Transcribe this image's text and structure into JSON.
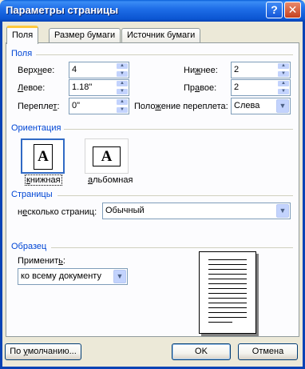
{
  "window": {
    "title": "Параметры страницы",
    "help_glyph": "?",
    "close_glyph": "✕"
  },
  "tabs": [
    {
      "label": "Поля",
      "active": true
    },
    {
      "label": "Размер бумаги",
      "active": false
    },
    {
      "label": "Источник бумаги",
      "active": false
    }
  ],
  "margins": {
    "group_label": "Поля",
    "top": {
      "label_pre": "Верх",
      "label_u": "н",
      "label_post": "ее:",
      "value": "4"
    },
    "left": {
      "label_pre": "",
      "label_u": "Л",
      "label_post": "евое:",
      "value": "1.18\""
    },
    "gutter": {
      "label_pre": "Перепле",
      "label_u": "т",
      "label_post": ":",
      "value": "0\""
    },
    "bottom": {
      "label_pre": "Ни",
      "label_u": "ж",
      "label_post": "нее:",
      "value": "2"
    },
    "right": {
      "label_pre": "Пр",
      "label_u": "а",
      "label_post": "вое:",
      "value": "2"
    },
    "gutter_position": {
      "label_pre": "Поло",
      "label_u": "ж",
      "label_post": "ение переплета:",
      "value": "Слева"
    }
  },
  "orientation": {
    "group_label": "Ориентация",
    "portrait": {
      "label_pre": "",
      "label_u": "к",
      "label_post": "нижная",
      "glyph": "A",
      "selected": true
    },
    "landscape": {
      "label_pre": "",
      "label_u": "а",
      "label_post": "льбомная",
      "glyph": "A",
      "selected": false
    }
  },
  "pages": {
    "group_label": "Страницы",
    "multiple": {
      "label_pre": "н",
      "label_u": "е",
      "label_post": "сколько страниц:",
      "value": "Обычный"
    }
  },
  "sample": {
    "group_label": "Образец",
    "apply": {
      "label_pre": "Применит",
      "label_u": "ь",
      "label_post": ":",
      "value": "ко всему документу"
    }
  },
  "buttons": {
    "default": {
      "label_pre": "По ",
      "label_u": "у",
      "label_post": "молчанию..."
    },
    "ok": "OK",
    "cancel": "Отмена"
  },
  "colors": {
    "title_bar": "#0b55d2",
    "group_label": "#0046d5",
    "selection": "#316ac5",
    "tab_highlight": "#ffc83c"
  }
}
